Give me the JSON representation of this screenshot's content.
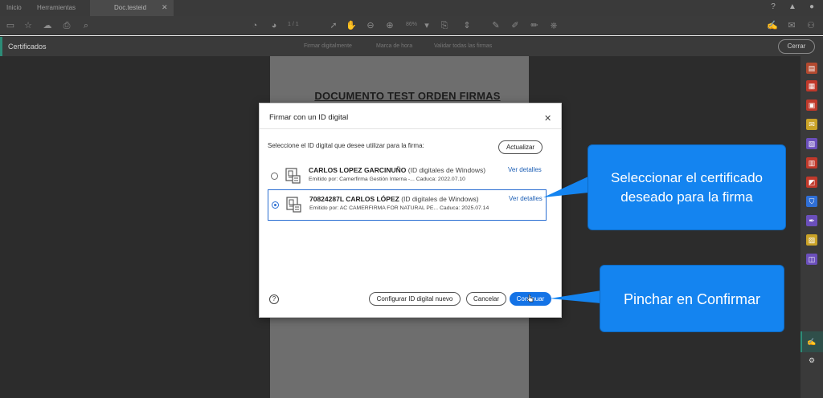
{
  "tabs": {
    "home": "Inicio",
    "tools": "Herramientas",
    "document": "Doc.testeid"
  },
  "toolbar": {
    "page_indicator": "1  /  1",
    "zoom": "86%"
  },
  "cert_panel": {
    "title": "Certificados",
    "options": [
      "Firmar digitalmente",
      "Marca de hora",
      "Validar todas las firmas"
    ],
    "close_label": "Cerrar"
  },
  "document": {
    "title": "DOCUMENTO TEST ORDEN FIRMAS"
  },
  "dialog": {
    "title": "Firmar con un ID digital",
    "instruction": "Seleccione el ID digital que desee utilizar para la firma:",
    "refresh_label": "Actualizar",
    "certificates": [
      {
        "name": "CARLOS LOPEZ GARCINUÑO",
        "type": "(ID digitales de Windows)",
        "details": "Emitido por: Camerfirma Gestión Interna -... Caduca: 2022.07.10",
        "link": "Ver detalles",
        "selected": false
      },
      {
        "name": "70824287L CARLOS LÓPEZ",
        "type": "(ID digitales de Windows)",
        "details": "Emitido por: AC CAMERFIRMA FOR NATURAL PE... Caduca: 2025.07.14",
        "link": "Ver detalles",
        "selected": true
      }
    ],
    "help_symbol": "?",
    "configure_label": "Configurar ID digital nuevo",
    "cancel_label": "Cancelar",
    "continue_label": "Continuar"
  },
  "callouts": {
    "select_line1": "Seleccionar el certificado",
    "select_line2": "deseado para la firma",
    "confirm": "Pinchar en Confirmar"
  },
  "colors": {
    "primary_button": "#1473e6",
    "callout": "#1484f0",
    "accent": "#2d8c77",
    "selection_border": "#2a6ed2"
  }
}
